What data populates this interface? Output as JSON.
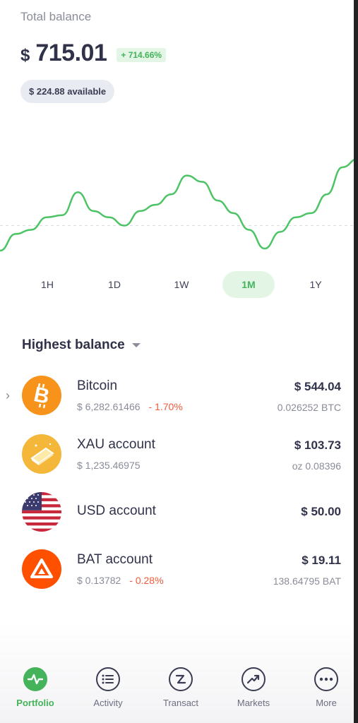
{
  "header": {
    "total_label": "Total balance",
    "currency": "$",
    "amount": "715.01",
    "change": "+ 714.66%",
    "available": "$ 224.88 available"
  },
  "chart_data": {
    "type": "line",
    "color": "#4cc466",
    "x": [
      0,
      1,
      2,
      3,
      4,
      5,
      6,
      7,
      8,
      9,
      10,
      11,
      12,
      13,
      14,
      15,
      16,
      17,
      18,
      19,
      20,
      21,
      22,
      23
    ],
    "values": [
      2,
      10,
      12,
      18,
      19,
      30,
      21,
      18,
      14,
      21,
      24,
      29,
      38,
      35,
      26,
      20,
      12,
      3,
      11,
      18,
      20,
      29,
      42,
      46
    ],
    "baseline": 12
  },
  "timeframes": {
    "items": [
      "1H",
      "1D",
      "1W",
      "1M",
      "1Y"
    ],
    "active": "1M"
  },
  "list": {
    "title": "Highest balance",
    "assets": [
      {
        "name": "Bitcoin",
        "price": "$ 6,282.61466",
        "change": "- 1.70%",
        "value": "$ 544.04",
        "quantity": "0.026252 BTC",
        "icon": "bitcoin-icon",
        "color": "#f7931a"
      },
      {
        "name": "XAU account",
        "price": "$ 1,235.46975",
        "change": "",
        "value": "$ 103.73",
        "quantity": "oz 0.08396",
        "icon": "gold-bar-icon",
        "color": "#f4b73a"
      },
      {
        "name": "USD account",
        "price": "",
        "change": "",
        "value": "$ 50.00",
        "quantity": "",
        "icon": "us-flag-icon",
        "color": "#b22234"
      },
      {
        "name": "BAT account",
        "price": "$ 0.13782",
        "change": "- 0.28%",
        "value": "$ 19.11",
        "quantity": "138.64795 BAT",
        "icon": "bat-triangle-icon",
        "color": "#ff5000"
      }
    ]
  },
  "tabs": [
    {
      "label": "Portfolio",
      "icon": "pulse-icon",
      "active": true
    },
    {
      "label": "Activity",
      "icon": "list-icon",
      "active": false
    },
    {
      "label": "Transact",
      "icon": "transfer-icon",
      "active": false
    },
    {
      "label": "Markets",
      "icon": "trend-up-icon",
      "active": false
    },
    {
      "label": "More",
      "icon": "more-dots-icon",
      "active": false
    }
  ]
}
